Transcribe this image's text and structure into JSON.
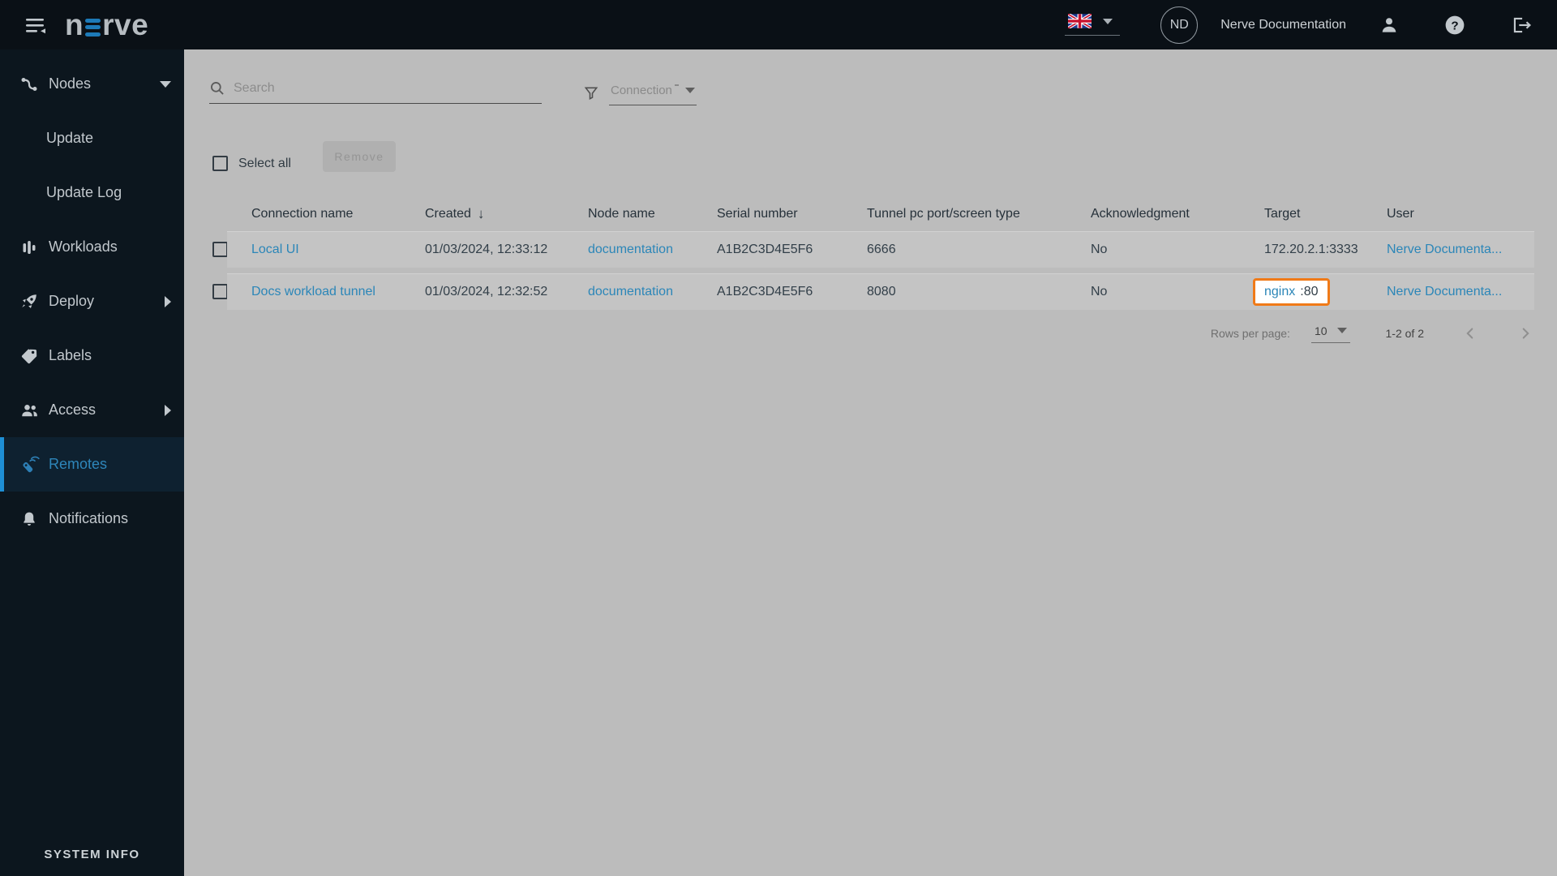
{
  "topbar": {
    "logo_n": "n",
    "logo_rve": "rve",
    "avatar_initials": "ND",
    "account_name": "Nerve Documentation"
  },
  "sidebar": {
    "items": [
      {
        "label": "Nodes"
      },
      {
        "label": "Update"
      },
      {
        "label": "Update Log"
      },
      {
        "label": "Workloads"
      },
      {
        "label": "Deploy"
      },
      {
        "label": "Labels"
      },
      {
        "label": "Access"
      },
      {
        "label": "Remotes"
      },
      {
        "label": "Notifications"
      }
    ],
    "system_info_label": "SYSTEM INFO"
  },
  "main": {
    "search_placeholder": "Search",
    "filter_label": "Connection",
    "select_all_label": "Select all",
    "remove_button_label": "Remove",
    "table": {
      "columns": [
        "Connection name",
        "Created",
        "Node name",
        "Serial number",
        "Tunnel pc port/screen type",
        "Acknowledgment",
        "Target",
        "User"
      ],
      "rows": [
        {
          "connection": "Local UI",
          "created": "01/03/2024, 12:33:12",
          "node": "documentation",
          "serial": "A1B2C3D4E5F6",
          "tunnel": "6666",
          "ack": "No",
          "target": "172.20.2.1:3333",
          "user": "Nerve Documenta..."
        },
        {
          "connection": "Docs workload tunnel",
          "created": "01/03/2024, 12:32:52",
          "node": "documentation",
          "serial": "A1B2C3D4E5F6",
          "tunnel": "8080",
          "ack": "No",
          "target_link": "nginx",
          "target_suffix": ":80",
          "user": "Nerve Documenta..."
        }
      ]
    },
    "pagination": {
      "rows_per_page_label": "Rows per page:",
      "rows_per_page_value": "10",
      "range": "1-2 of 2"
    }
  },
  "colors": {
    "accent_blue": "#1e8fd5",
    "link_blue": "#2b86b8",
    "highlight_orange": "#f07a18",
    "sidebar_bg": "#0c161e",
    "topbar_bg": "#0a1016",
    "content_bg": "#bcbcbc"
  }
}
